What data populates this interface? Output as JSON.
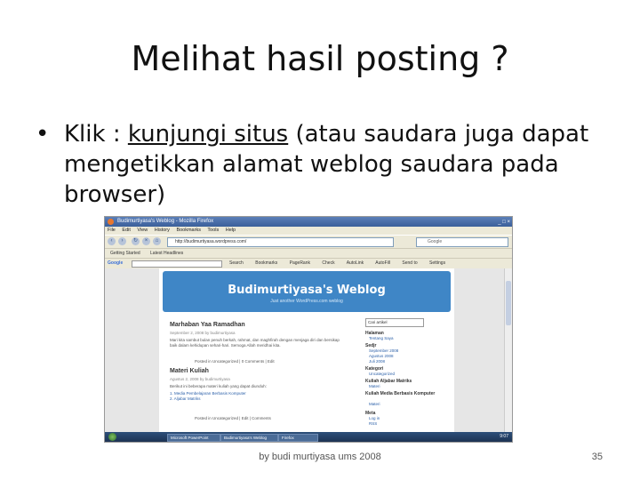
{
  "slide": {
    "title": "Melihat hasil posting ?",
    "bullet_marker": "•",
    "bullet_prefix": "Klik : ",
    "bullet_link": "kunjungi situs",
    "bullet_rest": "   (atau saudara juga dapat mengetikkan alamat weblog saudara pada browser)",
    "footer": "by budi murtiyasa ums 2008",
    "page_number": "35"
  },
  "browser": {
    "window_title": "Budimurtiyasa's Weblog - Mozilla Firefox",
    "window_buttons": "_ □ ×",
    "menu": [
      "File",
      "Edit",
      "View",
      "History",
      "Bookmarks",
      "Tools",
      "Help"
    ],
    "address": "http://budimurtiyasa.wordpress.com/",
    "search_placeholder": "Google",
    "bookmarks": [
      "Getting Started",
      "Latest Headlines"
    ],
    "google_logo": "Google",
    "google_items": [
      "Search",
      "Bookmarks",
      "PageRank",
      "Check",
      "AutoLink",
      "AutoFill",
      "Send to",
      "Settings"
    ]
  },
  "blog": {
    "title": "Budimurtiyasa's Weblog",
    "tagline": "Just another WordPress.com weblog",
    "post1_title": "Marhaban Yaa Ramadhan",
    "post1_meta": "September 2, 2008 by budimurtiyasa",
    "post1_body": "Mari kita sambut bulan penuh berkah, rahmat, dan maghfirah dengan menjaga diri dan bersikap baik dalam kehidupan sehari-hari. Semoga Allah meridhai kita.",
    "post1_links": "Posted in Uncategorized | 0 Comments | Edit",
    "post2_title": "Materi Kuliah",
    "post2_meta": "Agustus 2, 2008 by budimurtiyasa",
    "post2_body": "Berikut ini beberapa materi kuliah yang dapat diunduh:",
    "post2_list": [
      "1. Media Pembelajaran Berbasis Komputer",
      "2. Aljabar Matriks"
    ],
    "post2_comments": "Posted in Uncategorized | Edit | Comments",
    "sidebar_search": "Cari artikel",
    "sb_heads": [
      "Halaman",
      "Sedjr",
      "Kategori",
      "Kuliah Aljabar Matriks",
      "Kuliah Media Berbasis Komputer",
      "Meta"
    ],
    "sb_items": [
      "Tentang Saya",
      "September 2008",
      "Agustus 2008",
      "Juli 2008",
      "Uncategorized",
      "Materi",
      "Materi",
      "Log in",
      "RSS"
    ]
  },
  "taskbar": {
    "tasks": [
      "Microsoft PowerPoint",
      "Budimurtiyasa's Weblog",
      "Firefox"
    ],
    "clock": "9:07"
  }
}
